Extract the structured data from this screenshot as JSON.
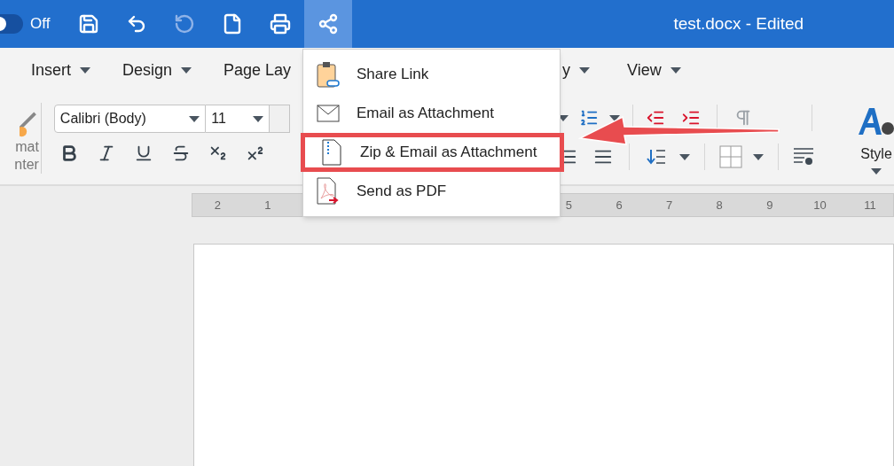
{
  "title_bar": {
    "toggle": {
      "label": "Off",
      "on": false
    },
    "title": "test.docx - Edited",
    "buttons": [
      {
        "kind": "save",
        "disabled": false,
        "active": false
      },
      {
        "kind": "undo",
        "disabled": false,
        "active": false
      },
      {
        "kind": "redo",
        "disabled": true,
        "active": false
      },
      {
        "kind": "new",
        "disabled": false,
        "active": false
      },
      {
        "kind": "print",
        "disabled": false,
        "active": false
      },
      {
        "kind": "share",
        "disabled": false,
        "active": true
      }
    ]
  },
  "menu_tabs_left": [
    {
      "label": "Insert",
      "caret": true
    },
    {
      "label": "Design",
      "caret": true
    },
    {
      "label": "Page Lay",
      "caret": false
    }
  ],
  "menu_tabs_right": [
    {
      "label": "y",
      "caret": true
    },
    {
      "label": "View",
      "caret": true
    }
  ],
  "ribbon": {
    "painter_lines": [
      "mat",
      "nter"
    ],
    "font": {
      "value": "Calibri (Body)"
    },
    "size": {
      "value": "11"
    },
    "styles_label": "Style"
  },
  "ruler": {
    "left_labels": [
      "2",
      "1"
    ],
    "right_labels": [
      "5",
      "6",
      "7",
      "8",
      "9",
      "10",
      "11"
    ]
  },
  "share_menu": {
    "items": [
      {
        "kind": "link",
        "label": "Share Link",
        "highlighted": false
      },
      {
        "kind": "email",
        "label": "Email as Attachment",
        "highlighted": false
      },
      {
        "kind": "zip",
        "label": "Zip & Email as Attachment",
        "highlighted": true
      },
      {
        "kind": "pdf",
        "label": "Send as PDF",
        "highlighted": false
      }
    ]
  }
}
